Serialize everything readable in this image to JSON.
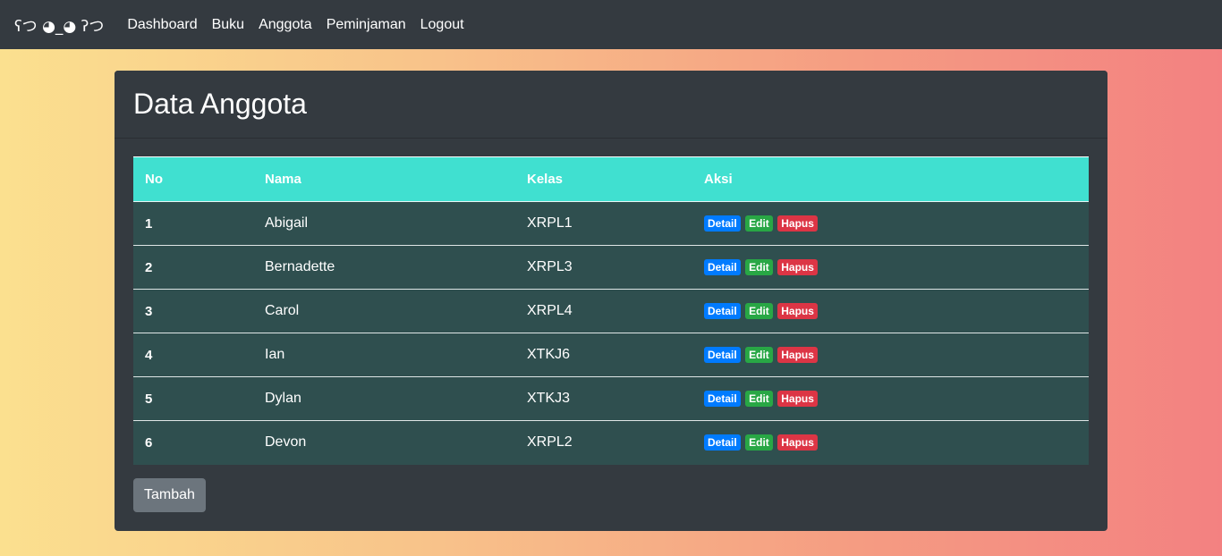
{
  "navbar": {
    "brand": "ʕつ ◕_◕ ʔつ",
    "links": [
      "Dashboard",
      "Buku",
      "Anggota",
      "Peminjaman",
      "Logout"
    ]
  },
  "card": {
    "title": "Data Anggota"
  },
  "table": {
    "headers": [
      "No",
      "Nama",
      "Kelas",
      "Aksi"
    ],
    "rows": [
      {
        "no": "1",
        "nama": "Abigail",
        "kelas": "XRPL1"
      },
      {
        "no": "2",
        "nama": "Bernadette",
        "kelas": "XRPL3"
      },
      {
        "no": "3",
        "nama": "Carol",
        "kelas": "XRPL4"
      },
      {
        "no": "4",
        "nama": "Ian",
        "kelas": "XTKJ6"
      },
      {
        "no": "5",
        "nama": "Dylan",
        "kelas": "XTKJ3"
      },
      {
        "no": "6",
        "nama": "Devon",
        "kelas": "XRPL2"
      }
    ],
    "actions": {
      "detail": "Detail",
      "edit": "Edit",
      "hapus": "Hapus"
    }
  },
  "buttons": {
    "tambah": "Tambah"
  },
  "colors": {
    "navbar": "#343a40",
    "table_header": "#40e0d0",
    "table_row": "#2f4f4f",
    "detail": "#007bff",
    "edit": "#28a745",
    "hapus": "#dc3545",
    "tambah": "#6c757d"
  }
}
